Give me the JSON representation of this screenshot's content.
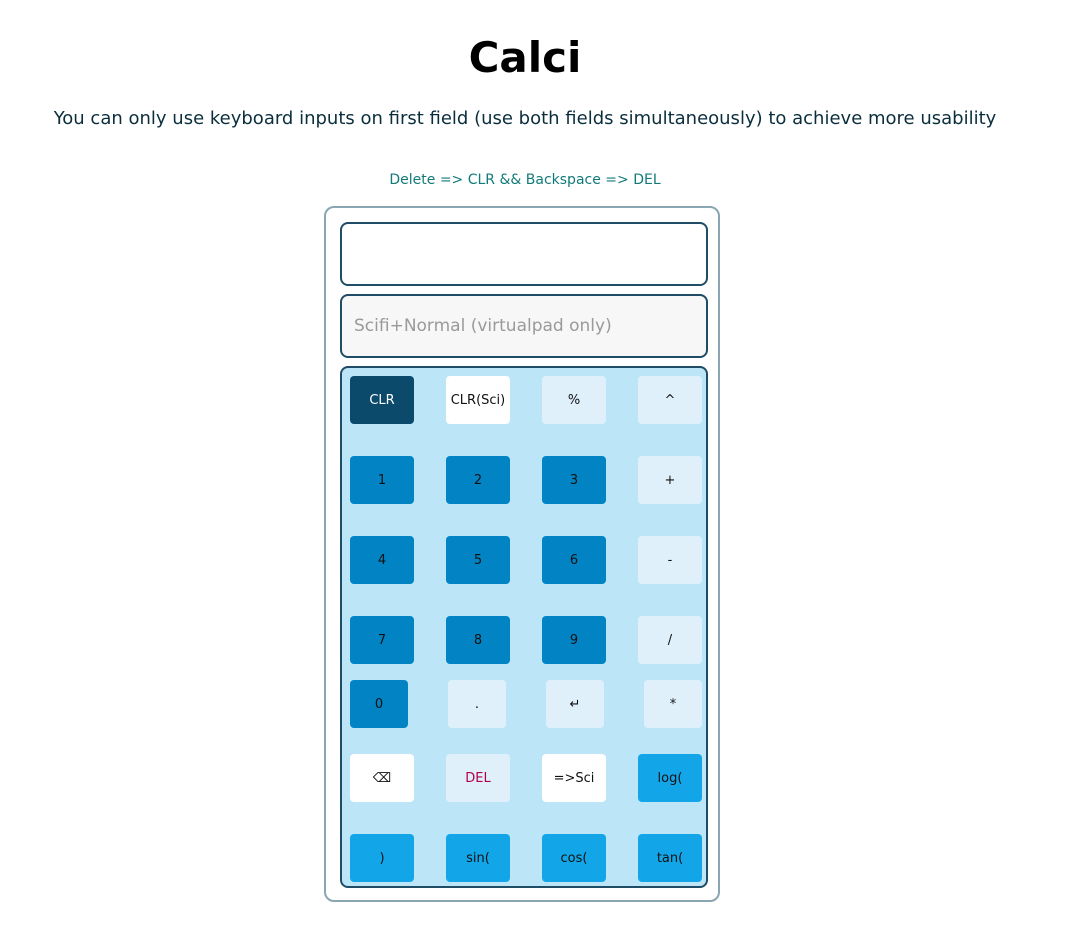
{
  "header": {
    "title": "Calci",
    "subtitle": "You can only use keyboard inputs on first field (use both fields simultaneously) to achieve more usability",
    "hint": "Delete => CLR && Backspace => DEL"
  },
  "fields": {
    "main_value": "",
    "sci_placeholder": "Scifi+Normal (virtualpad only)"
  },
  "keys": {
    "clr": "CLR",
    "clr_sci": "CLR(Sci)",
    "percent": "%",
    "power": "^",
    "one": "1",
    "two": "2",
    "three": "3",
    "plus": "+",
    "four": "4",
    "five": "5",
    "six": "6",
    "minus": "-",
    "seven": "7",
    "eight": "8",
    "nine": "9",
    "divide": "/",
    "zero": "0",
    "dot": ".",
    "enter": "↵",
    "multiply": "*",
    "backspace": "⌫",
    "del": "DEL",
    "to_sci": "=>Sci",
    "log": "log(",
    "close_paren": ")",
    "sin": "sin(",
    "cos": "cos(",
    "tan": "tan("
  },
  "colors": {
    "dark_key": "#0b4a6b",
    "digit_key": "#0283c4",
    "operator_key": "#dff0fb",
    "function_key": "#12a6e8",
    "pad_background": "#bde5f8",
    "del_text": "#b3004a"
  }
}
